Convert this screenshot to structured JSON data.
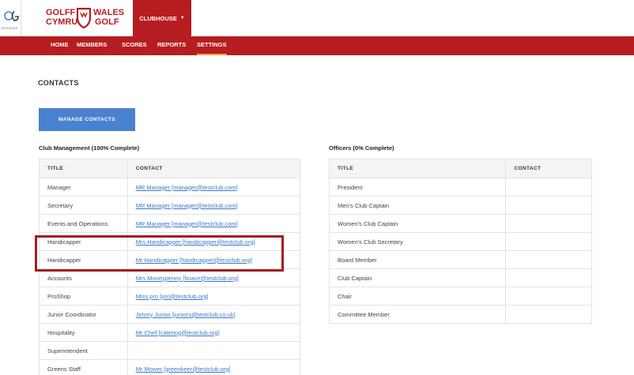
{
  "header": {
    "brand_left_small": "DOTGOLF",
    "brand_top_left": "GOLFF",
    "brand_top_right": "WALES",
    "brand_bottom_left": "CYMRU",
    "brand_bottom_right": "GOLF",
    "clubhouse_label": "CLUBHOUSE",
    "brand_color": "#b61d21",
    "accent_color": "#f0a039"
  },
  "nav": {
    "items": [
      {
        "label": "HOME"
      },
      {
        "label": "MEMBERS"
      },
      {
        "label": "SCORES"
      },
      {
        "label": "REPORTS"
      },
      {
        "label": "SETTINGS",
        "active": true
      }
    ]
  },
  "page": {
    "title": "CONTACTS",
    "manage_button": "MANAGE CONTACTS"
  },
  "club_management": {
    "title": "Club Management (100% Complete)",
    "columns": [
      "TITLE",
      "CONTACT"
    ],
    "rows": [
      {
        "title": "Manager",
        "contact": "MR Manager [manager@testclub.com]"
      },
      {
        "title": "Secretary",
        "contact": "MR Manager [manager@testclub.com]"
      },
      {
        "title": "Events and Operations",
        "contact": "MR Manager [manager@testclub.com]"
      },
      {
        "title": "Handicapper",
        "contact": "Mrs Handicapper [handicapper@testclub.org]"
      },
      {
        "title": "Handicapper",
        "contact": "Mr Handicapper [handicapper@testclub.org]"
      },
      {
        "title": "Accounts",
        "contact": "Mrs Moneypenny [finace@testclub.org]"
      },
      {
        "title": "ProShop",
        "contact": "Miss pro [pro@testclub.org]"
      },
      {
        "title": "Junior Coordinator",
        "contact": "Jimmy Junior [juniors@testclub.co.uk]"
      },
      {
        "title": "Hospitality",
        "contact": "Mr Chef [catering@testclub.org]"
      },
      {
        "title": "Superintendent",
        "contact": ""
      },
      {
        "title": "Greens Staff",
        "contact": "Mr Mower [greenkeer@testclub.org]"
      }
    ]
  },
  "officers": {
    "title": "Officers (0% Complete)",
    "columns": [
      "TITLE",
      "CONTACT"
    ],
    "rows": [
      {
        "title": "President",
        "contact": ""
      },
      {
        "title": "Men's Club Captain",
        "contact": ""
      },
      {
        "title": "Women's Club Captain",
        "contact": ""
      },
      {
        "title": "Women's Club Secretary",
        "contact": ""
      },
      {
        "title": "Board Member",
        "contact": ""
      },
      {
        "title": "Club Captain",
        "contact": ""
      },
      {
        "title": "Chair",
        "contact": ""
      },
      {
        "title": "Committee Member",
        "contact": ""
      }
    ]
  },
  "annotation": {
    "highlight_color": "#a41e22"
  }
}
